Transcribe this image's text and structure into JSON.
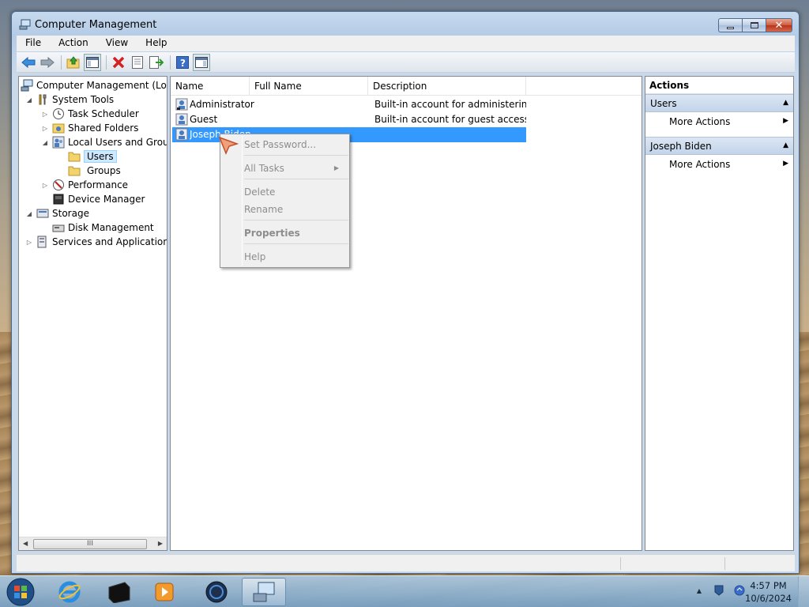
{
  "window": {
    "title": "Computer Management"
  },
  "menu": {
    "file": "File",
    "action": "Action",
    "view": "View",
    "help": "Help"
  },
  "toolbar": {
    "icons": [
      "back-icon",
      "forward-icon",
      "up-icon",
      "show-hide-tree-icon",
      "delete-icon",
      "properties-icon",
      "export-icon",
      "help-icon",
      "show-hide-action-pane-icon"
    ]
  },
  "tree": {
    "root": "Computer Management (Local",
    "system_tools": "System Tools",
    "task_scheduler": "Task Scheduler",
    "shared_folders": "Shared Folders",
    "local_users_groups": "Local Users and Groups",
    "users": "Users",
    "groups": "Groups",
    "performance": "Performance",
    "device_manager": "Device Manager",
    "storage": "Storage",
    "disk_management": "Disk Management",
    "services_apps": "Services and Applications",
    "scroll_thumb": "III"
  },
  "list": {
    "columns": {
      "name": "Name",
      "full_name": "Full Name",
      "description": "Description"
    },
    "rows": [
      {
        "name": "Administrator",
        "full_name": "",
        "description": "Built-in account for administering..."
      },
      {
        "name": "Guest",
        "full_name": "",
        "description": "Built-in account for guest access t..."
      },
      {
        "name": "Joseph Biden",
        "full_name": "",
        "description": ""
      }
    ]
  },
  "context_menu": {
    "set_password": "Set Password...",
    "all_tasks": "All Tasks",
    "delete": "Delete",
    "rename": "Rename",
    "properties": "Properties",
    "help": "Help"
  },
  "actions": {
    "header": "Actions",
    "section_users": "Users",
    "more_actions_1": "More Actions",
    "section_user": "Joseph Biden",
    "more_actions_2": "More Actions"
  },
  "taskbar": {
    "time": "4:57 PM",
    "date": "10/6/2024"
  }
}
